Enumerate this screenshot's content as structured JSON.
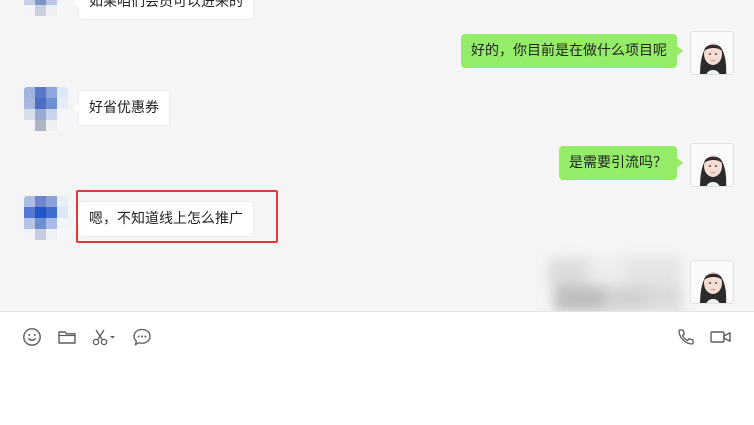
{
  "messages": [
    {
      "side": "left",
      "text": "如果咱们会员可以进来的"
    },
    {
      "side": "right",
      "text": "好的，你目前是在做什么项目呢"
    },
    {
      "side": "left",
      "text": "好省优惠券"
    },
    {
      "side": "right",
      "text": "是需要引流吗？"
    },
    {
      "side": "left",
      "text": "嗯，不知道线上怎么推广"
    }
  ],
  "toolbar": {
    "emoji": "emoji-icon",
    "file": "folder-icon",
    "screenshot": "scissors-icon",
    "chat_history": "chat-bubble-icon",
    "voice_call": "phone-icon",
    "video_call": "video-icon"
  },
  "colors": {
    "right_bubble": "#95ec69",
    "left_bubble": "#ffffff",
    "highlight": "#e0383b"
  }
}
